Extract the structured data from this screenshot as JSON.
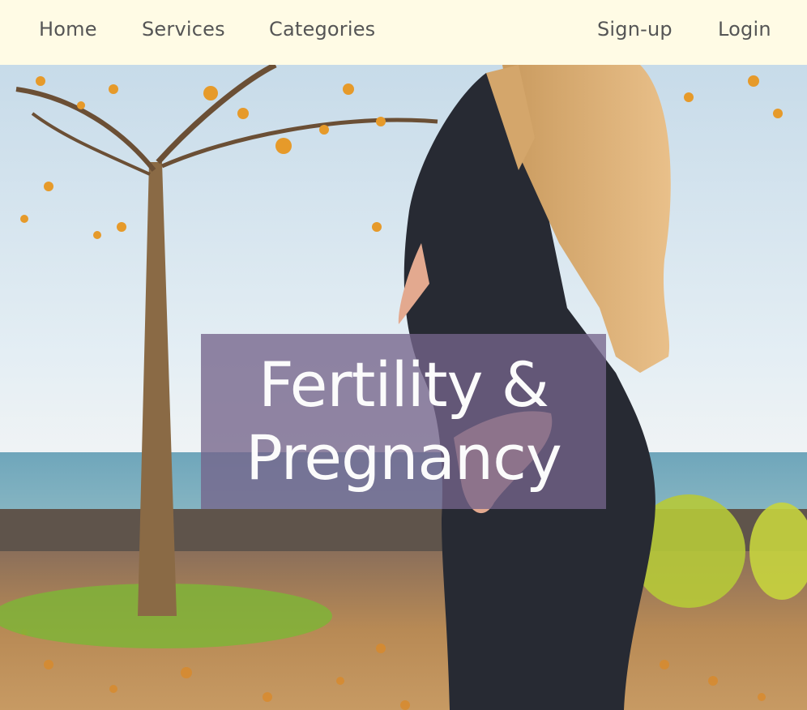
{
  "nav": {
    "home": "Home",
    "services": "Services",
    "categories": "Categories",
    "signup": "Sign-up",
    "login": "Login"
  },
  "hero": {
    "title_line1": "Fertility &",
    "title_line2": "Pregnancy"
  },
  "colors": {
    "nav_bg": "#fffbe5",
    "nav_text": "#555555",
    "title_box": "#74648a",
    "title_text": "#fbfbfb"
  }
}
